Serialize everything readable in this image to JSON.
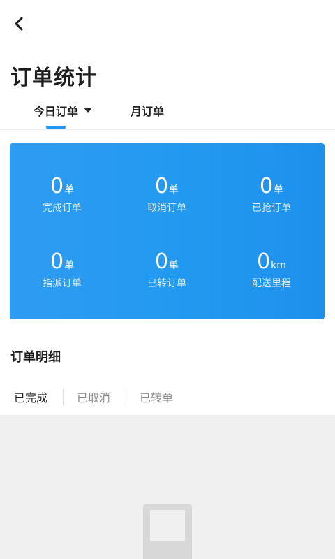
{
  "header": {
    "back_icon": "chevron-left-icon"
  },
  "page": {
    "title": "订单统计"
  },
  "tabs": [
    {
      "label": "今日订单",
      "active": true,
      "has_dropdown": true
    },
    {
      "label": "月订单",
      "active": false
    }
  ],
  "colors": {
    "accent": "#2196f3",
    "card_gradient_start": "#2f9bf2",
    "card_gradient_end": "#1e90ec"
  },
  "stats": [
    {
      "value": "0",
      "unit": "单",
      "label": "完成订单"
    },
    {
      "value": "0",
      "unit": "单",
      "label": "取消订单"
    },
    {
      "value": "0",
      "unit": "单",
      "label": "已抢订单"
    },
    {
      "value": "0",
      "unit": "单",
      "label": "指派订单"
    },
    {
      "value": "0",
      "unit": "单",
      "label": "已转订单"
    },
    {
      "value": "0",
      "unit": "km",
      "label": "配送里程"
    }
  ],
  "details": {
    "title": "订单明细",
    "filters": [
      {
        "label": "已完成",
        "active": true
      },
      {
        "label": "已取消",
        "active": false
      },
      {
        "label": "已转单",
        "active": false
      }
    ]
  },
  "empty_state": {
    "icon": "empty-inbox-icon"
  }
}
